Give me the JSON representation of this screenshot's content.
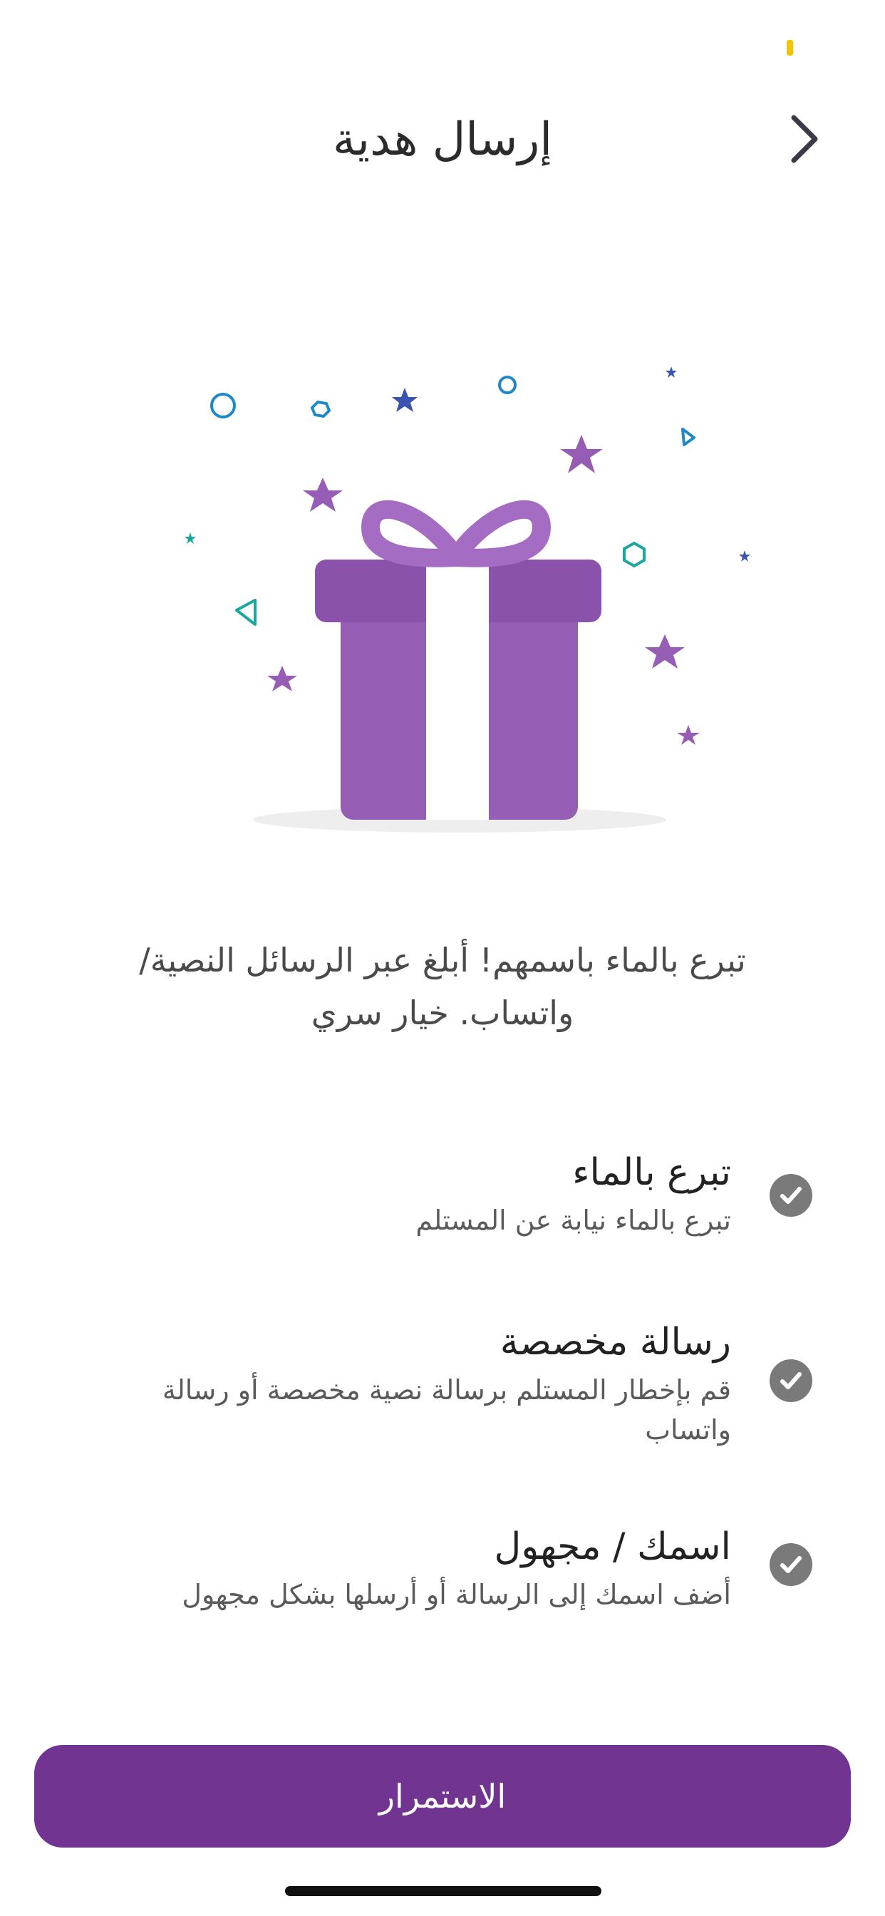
{
  "colors": {
    "primary": "#723491",
    "gift_purple": "#955db3",
    "gift_purple_dark": "#8a52aa",
    "ribbon_bow": "#a56cc4",
    "check_gray": "#7a7a7a",
    "status_yellow": "#f5c400",
    "star_blue": "#3a55b0",
    "outline_blue": "#1e88c8",
    "teal": "#1aa7a0"
  },
  "header": {
    "title": "إرسال هدية",
    "back_icon": "chevron-right-icon"
  },
  "description": "تبرع بالماء باسمهم! أبلغ عبر الرسائل النصية/ واتساب. خيار سري",
  "features": [
    {
      "title": "تبرع بالماء",
      "description": "تبرع بالماء نيابة عن المستلم",
      "icon": "check-circle-icon"
    },
    {
      "title": "رسالة مخصصة",
      "description": "قم بإخطار المستلم برسالة نصية مخصصة أو رسالة واتساب",
      "icon": "check-circle-icon"
    },
    {
      "title": "اسمك / مجهول",
      "description": "أضف اسمك إلى الرسالة أو أرسلها بشكل مجهول",
      "icon": "check-circle-icon"
    }
  ],
  "continue_label": "الاستمرار",
  "illustration_icon": "gift-box-icon"
}
